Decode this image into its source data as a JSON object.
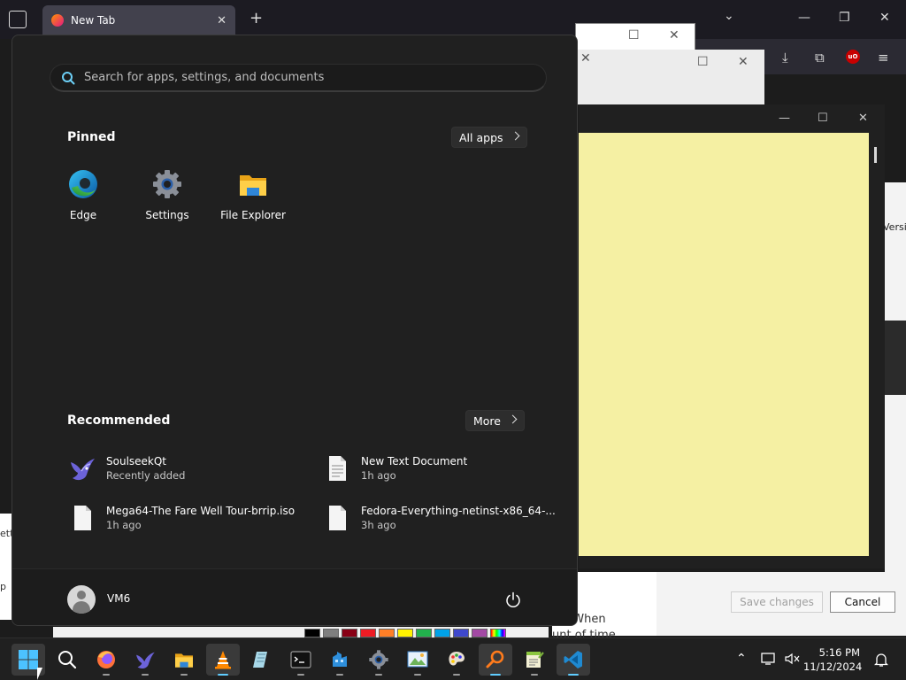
{
  "browser": {
    "tab_title": "New Tab"
  },
  "start_menu": {
    "search": {
      "placeholder": "Search for apps, settings, and documents"
    },
    "pinned": {
      "title": "Pinned",
      "all_apps_label": "All apps",
      "apps": [
        {
          "label": "Edge",
          "icon": "edge-icon"
        },
        {
          "label": "Settings",
          "icon": "settings-gear-icon"
        },
        {
          "label": "File Explorer",
          "icon": "folder-icon"
        }
      ]
    },
    "recommended": {
      "title": "Recommended",
      "more_label": "More",
      "items": [
        {
          "name": "SoulseekQt",
          "meta": "Recently added",
          "icon": "soulseek-bird-icon"
        },
        {
          "name": "New Text Document",
          "meta": "1h ago",
          "icon": "document-icon"
        },
        {
          "name": "Mega64-The Fare Well Tour-brrip.iso",
          "meta": "1h ago",
          "icon": "document-icon"
        },
        {
          "name": "Fedora-Everything-netinst-x86_64-...",
          "meta": "3h ago",
          "icon": "document-icon"
        }
      ]
    },
    "user": {
      "name": "VM6"
    }
  },
  "dialog": {
    "save_label": "Save changes",
    "cancel_label": "Cancel"
  },
  "background_text": {
    "right_versio": "Versio",
    "ns_when": "ns. When",
    "unt_of_time": "unt of time",
    "left_ett": "ett",
    "left_p": "p"
  },
  "taskbar": {
    "time": "5:16 PM",
    "date": "11/12/2024",
    "apps": [
      {
        "name": "start-button",
        "icon": "windows-logo-icon"
      },
      {
        "name": "search",
        "icon": "search-icon"
      },
      {
        "name": "firefox",
        "icon": "firefox-icon"
      },
      {
        "name": "soulseekqt",
        "icon": "soulseek-bird-icon"
      },
      {
        "name": "file-explorer",
        "icon": "folder-icon"
      },
      {
        "name": "vlc",
        "icon": "vlc-cone-icon"
      },
      {
        "name": "notepad-app",
        "icon": "notepad-icon"
      },
      {
        "name": "terminal",
        "icon": "terminal-icon"
      },
      {
        "name": "app-blue",
        "icon": "blue-app-icon"
      },
      {
        "name": "settings",
        "icon": "settings-gear-icon"
      },
      {
        "name": "paint",
        "icon": "paint-icon"
      },
      {
        "name": "paint-3d",
        "icon": "palette-icon"
      },
      {
        "name": "search-everything",
        "icon": "magnifier-orange-icon"
      },
      {
        "name": "notepad-plus-plus",
        "icon": "notepadpp-icon"
      },
      {
        "name": "vscode",
        "icon": "vscode-icon"
      }
    ]
  },
  "colors": {
    "accent": "#60cdff",
    "start_bg": "#202020",
    "sticky_note": "#f5f0a3"
  }
}
